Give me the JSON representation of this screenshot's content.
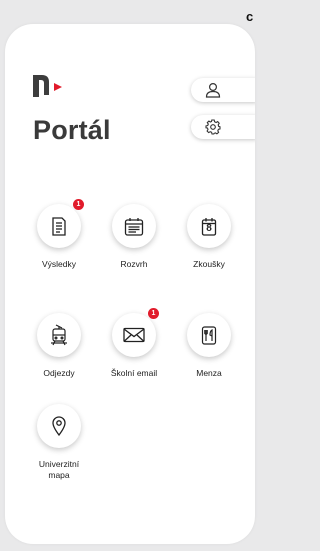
{
  "corner_text": "c",
  "app": {
    "title": "Portál"
  },
  "side_buttons": [
    {
      "icon": "user-icon"
    },
    {
      "icon": "gear-icon"
    }
  ],
  "tiles": [
    {
      "label": "Výsledky",
      "icon": "document-icon",
      "badge": "1"
    },
    {
      "label": "Rozvrh",
      "icon": "schedule-icon",
      "badge": ""
    },
    {
      "label": "Zkoušky",
      "icon": "calendar-icon",
      "badge": "",
      "icon_text": "8"
    },
    {
      "label": "Odjezdy",
      "icon": "tram-icon",
      "badge": ""
    },
    {
      "label": "Školní email",
      "icon": "mail-icon",
      "badge": "1"
    },
    {
      "label": "Menza",
      "icon": "cutlery-icon",
      "badge": ""
    },
    {
      "label_line1": "Univerzitní",
      "label_line2": "mapa",
      "icon": "location-pin-icon",
      "badge": ""
    }
  ],
  "colors": {
    "accent": "#e11b2b",
    "logo": "#3d3d3d",
    "background": "#e9e9ea"
  }
}
